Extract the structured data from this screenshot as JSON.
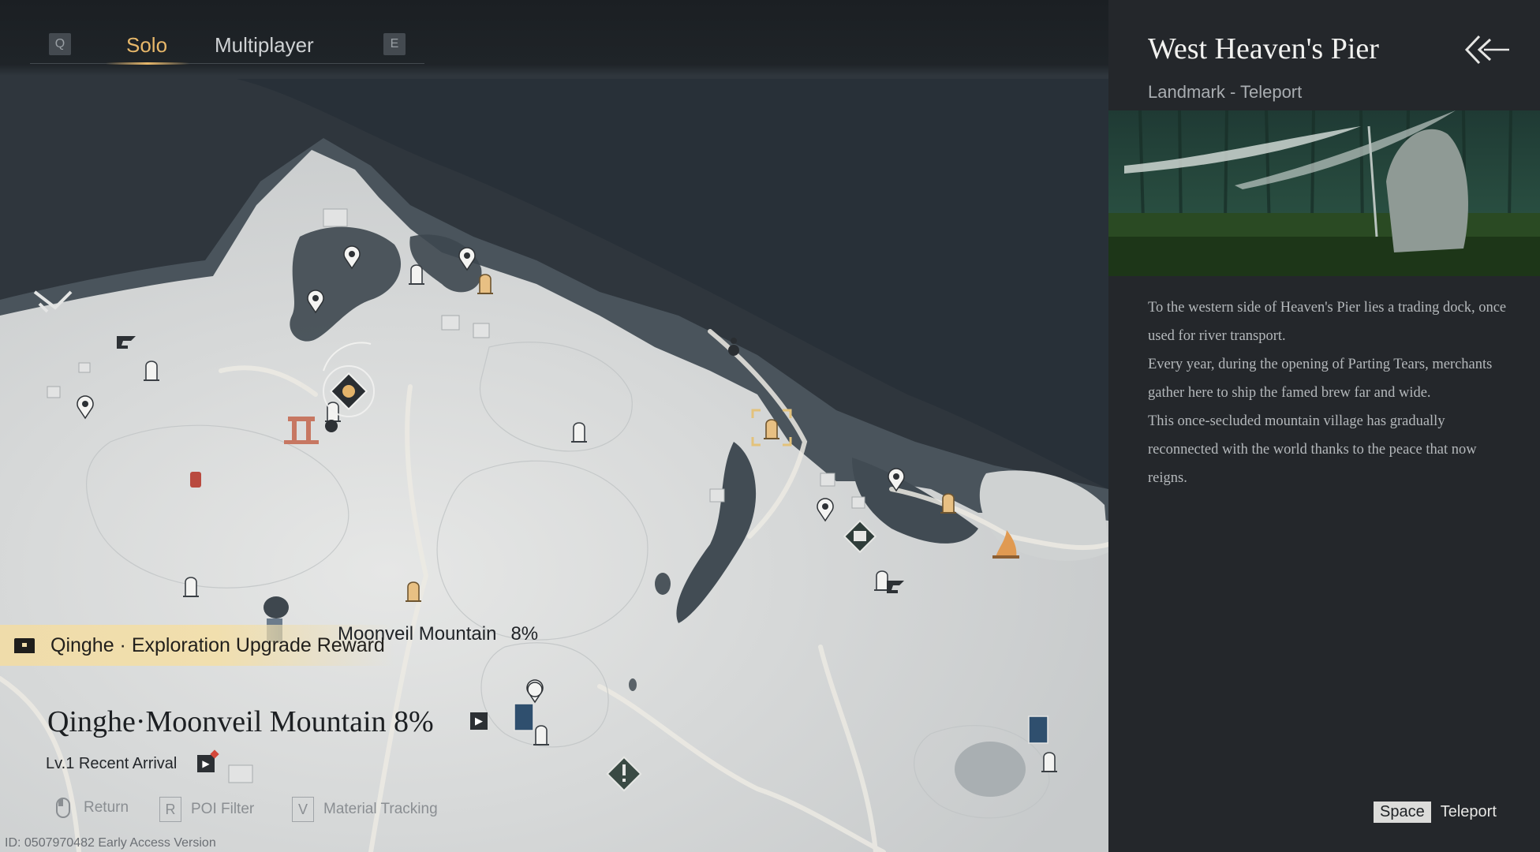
{
  "tabs": {
    "prev_key": "Q",
    "next_key": "E",
    "items": [
      {
        "label": "Solo",
        "active": true
      },
      {
        "label": "Multiplayer",
        "active": false
      }
    ]
  },
  "map": {
    "reward_banner": "Qinghe · Exploration Upgrade Reward",
    "area_label": {
      "name": "Moonveil Mountain",
      "percent": "8%"
    },
    "region_title": "Qinghe·Moonveil Mountain 8%",
    "rank": "Lv.1 Recent Arrival",
    "hints": [
      {
        "key": "",
        "label": "Return",
        "icon": "mouse-icon"
      },
      {
        "key": "R",
        "label": "POI Filter"
      },
      {
        "key": "V",
        "label": "Material Tracking"
      }
    ],
    "build_id": "ID: 0507970482 Early Access Version"
  },
  "panel": {
    "title": "West Heaven's Pier",
    "subtitle": "Landmark - Teleport",
    "description": [
      "To the western side of Heaven's Pier lies a trading dock, once used for river transport.",
      "Every year, during the opening of Parting Tears, merchants gather here to ship the famed brew far and wide.",
      "This once-secluded mountain village has gradually reconnected with the world thanks to the peace that now reigns."
    ],
    "action": {
      "key": "Space",
      "label": "Teleport"
    }
  },
  "colors": {
    "accent": "#e8b86a",
    "panel_bg": "#24272b",
    "land": "#d3d5d4",
    "water": "#3c454d",
    "banner": "#efdcaa"
  }
}
